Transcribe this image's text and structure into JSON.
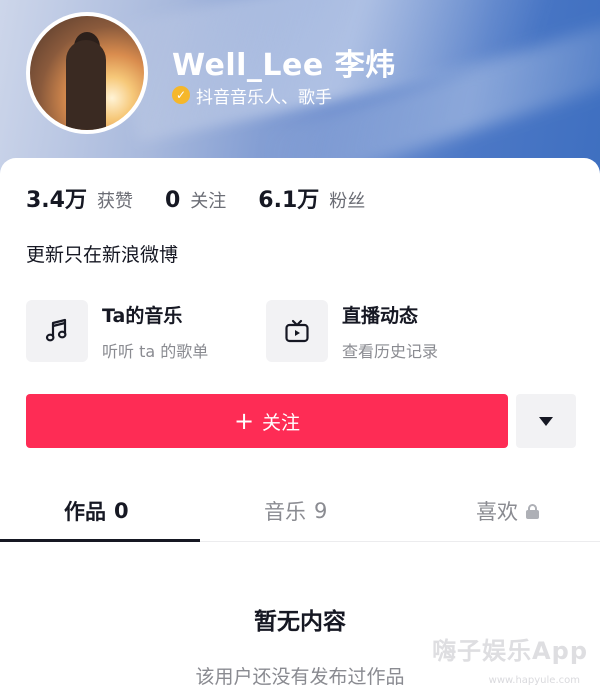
{
  "profile": {
    "username": "Well_Lee 李炜",
    "verified_label": "抖音音乐人、歌手",
    "verified_icon": "check-icon",
    "bio": "更新只在新浪微博"
  },
  "stats": [
    {
      "value": "3.4万",
      "label": "获赞"
    },
    {
      "value": "0",
      "label": "关注"
    },
    {
      "value": "6.1万",
      "label": "粉丝"
    }
  ],
  "features": {
    "music": {
      "title": "Ta的音乐",
      "subtitle": "听听 ta 的歌单",
      "icon": "music-note-icon"
    },
    "live": {
      "title": "直播动态",
      "subtitle": "查看历史记录",
      "icon": "tv-icon"
    }
  },
  "actions": {
    "follow_label": "关注",
    "follow_icon": "plus-icon",
    "more_icon": "caret-down-icon"
  },
  "tabs": [
    {
      "label": "作品",
      "count": "0"
    },
    {
      "label": "音乐",
      "count": "9"
    },
    {
      "label": "喜欢",
      "count": ""
    }
  ],
  "empty_state": {
    "title": "暂无内容",
    "subtitle": "该用户还没有发布过作品"
  },
  "watermark": {
    "text": "嗨子娱乐App",
    "url": "www.hapyule.com"
  },
  "colors": {
    "accent": "#fe2c55",
    "verified": "#f5b72b",
    "text_primary": "#161823",
    "text_secondary": "#8a8b91"
  }
}
